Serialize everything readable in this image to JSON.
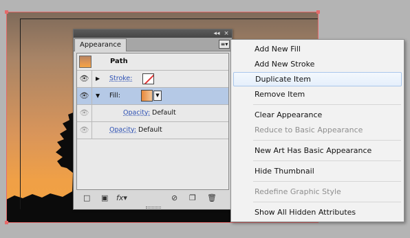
{
  "panel": {
    "tab_label": "Appearance",
    "header_title": "Path",
    "rows": [
      {
        "label": "Stroke:"
      },
      {
        "label": "Fill:"
      },
      {
        "label": "Opacity:",
        "value": "Default"
      },
      {
        "label": "Opacity:",
        "value": "Default"
      }
    ]
  },
  "menu": {
    "items": [
      {
        "label": "Add New Fill"
      },
      {
        "label": "Add New Stroke"
      },
      {
        "label": "Duplicate Item"
      },
      {
        "label": "Remove Item"
      },
      {
        "label": "Clear Appearance"
      },
      {
        "label": "Reduce to Basic Appearance"
      },
      {
        "label": "New Art Has Basic Appearance"
      },
      {
        "label": "Hide Thumbnail"
      },
      {
        "label": "Redefine Graphic Style"
      },
      {
        "label": "Show All Hidden Attributes"
      }
    ],
    "highlighted": "Duplicate Item",
    "disabled": [
      "Reduce to Basic Appearance",
      "Redefine Graphic Style"
    ]
  },
  "icons": {
    "visibility": "eye-icon",
    "expand": "triangle-right-icon",
    "collapse": "triangle-down-icon",
    "bottom_bar": [
      "add-stroke-icon",
      "add-fill-icon",
      "fx-icon",
      "clear-icon",
      "duplicate-icon",
      "trash-icon"
    ]
  },
  "colors": {
    "selection": "#e56a6a",
    "menu_highlight": "#e5effb",
    "selected_row": "#b5c9e6",
    "link_text": "#2b4fb3"
  }
}
